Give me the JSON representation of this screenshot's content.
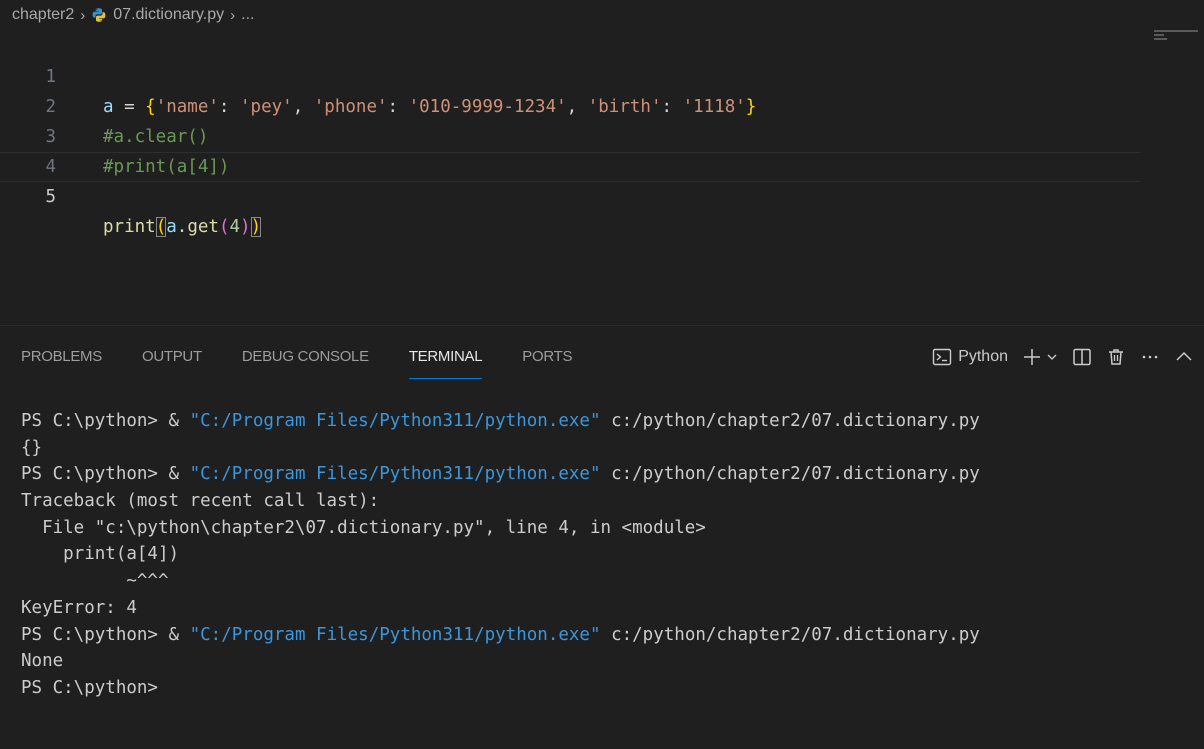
{
  "editor": {
    "breadcrumb": {
      "folder": "chapter2",
      "file": "07.dictionary.py",
      "ellipsis": "..."
    },
    "lines": [
      {
        "number": "1",
        "text": "a = {'name': 'pey', 'phone': '010-9999-1234', 'birth': '1118'}"
      },
      {
        "number": "2",
        "text": "#a.clear()"
      },
      {
        "number": "3",
        "text": "#print(a[4])"
      },
      {
        "number": "4",
        "text": ""
      },
      {
        "number": "5",
        "text": "print(a.get(4))"
      }
    ],
    "current_line": "5"
  },
  "panel": {
    "tabs": [
      {
        "label": "PROBLEMS"
      },
      {
        "label": "OUTPUT"
      },
      {
        "label": "DEBUG CONSOLE"
      },
      {
        "label": "TERMINAL"
      },
      {
        "label": "PORTS"
      }
    ],
    "active_tab": "TERMINAL",
    "terminal_name": "Python",
    "icons": [
      "terminal-icon",
      "plus-icon",
      "chevron-down-icon",
      "split-icon",
      "trash-icon",
      "more-icon",
      "chevron-up-icon"
    ]
  },
  "terminal": {
    "prompt": "PS C:\\python>",
    "amp": "&",
    "exe_path": "\"C:/Program Files/Python311/python.exe\"",
    "script_path": "c:/python/chapter2/07.dictionary.py",
    "out1": "{}",
    "traceback": "Traceback (most recent call last):",
    "file_line": "  File \"c:\\python\\chapter2\\07.dictionary.py\", line 4, in <module>",
    "code_line": "    print(a[4])",
    "caret_line": "          ~^^^",
    "error": "KeyError: 4",
    "out3": "None"
  },
  "colors": {
    "background": "#1f1f1f",
    "accent": "#0078d4",
    "path": "#3a96dd",
    "string": "#ce9178",
    "comment": "#6a9955"
  }
}
